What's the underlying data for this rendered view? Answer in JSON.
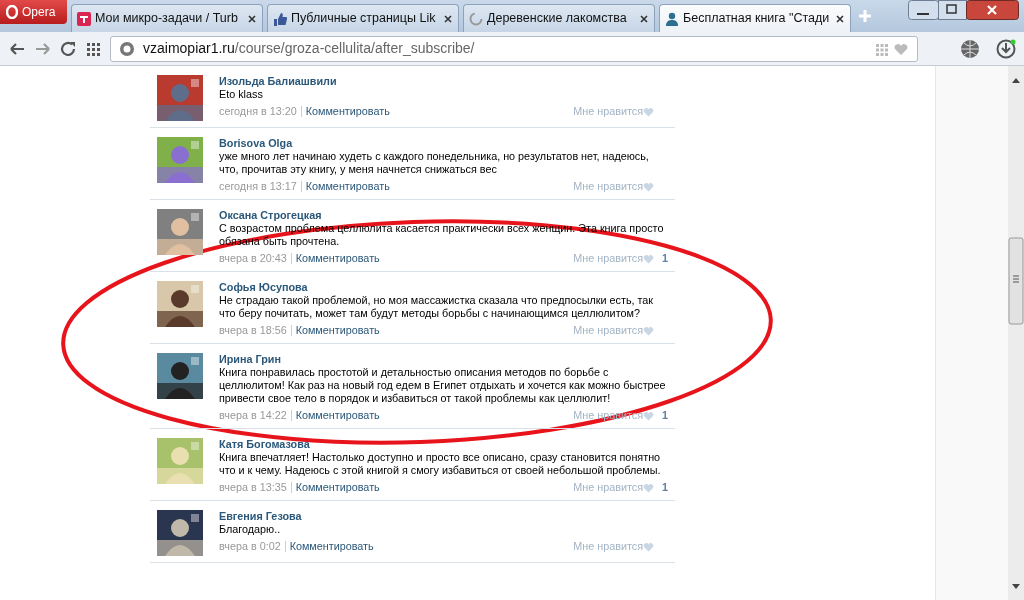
{
  "browser": {
    "menu_button": "Opera",
    "tabs": [
      {
        "title": "Мои микро-задачи / Turb",
        "selected": false
      },
      {
        "title": "Публичные страницы Lik",
        "selected": false
      },
      {
        "title": "Деревенские лакомства",
        "selected": false
      },
      {
        "title": "Бесплатная книга \"Стади",
        "selected": true
      }
    ],
    "address": {
      "host": "vzaimopiar1.ru",
      "path": "/course/groza-cellulita/after_subscribe/"
    }
  },
  "comments": [
    {
      "author": "Изольда Балиашвили",
      "text": "Eto klass",
      "time": "сегодня в 13:20",
      "reply": "Комментировать",
      "like": "Мне нравится"
    },
    {
      "author": "Borisova Olga",
      "text": "уже много лет начинаю худеть с каждого понедельника, но результатов нет, надеюсь, что, прочитав эту книгу, у меня начнется снижаться вес",
      "time": "сегодня в 13:17",
      "reply": "Комментировать",
      "like": "Мне нравится"
    },
    {
      "author": "Оксана Строгецкая",
      "text": "С возрастом проблема целлюлита касается практически всех женщин. Эта книга просто обязана быть прочтена.",
      "time": "вчера в 20:43",
      "reply": "Комментировать",
      "like": "Мне нравится",
      "likes": "1"
    },
    {
      "author": "Софья Юсупова",
      "text": "Не страдаю такой проблемой, но моя массажистка сказала что предпосылки есть, так что беру почитать, может там будут методы борьбы с начинающимся целлюлитом?",
      "time": "вчера в 18:56",
      "reply": "Комментировать",
      "like": "Мне нравится"
    },
    {
      "author": "Ирина Грин",
      "text": "Книга понравилась простотой и детальностью описания методов по борьбе с целлюлитом! Как раз на новый год едем в Египет отдыхать и хочется как можно быстрее привести свое тело в порядок и избавиться от такой проблемы как целлюлит!",
      "time": "вчера в 14:22",
      "reply": "Комментировать",
      "like": "Мне нравится",
      "likes": "1"
    },
    {
      "author": "Катя Богомазова",
      "text": "Книга впечатляет! Настолько доступно и просто все описано, сразу становится понятно что и к чему. Надеюсь с этой книгой я смогу избавиться от своей небольшой проблемы.",
      "time": "вчера в 13:35",
      "reply": "Комментировать",
      "like": "Мне нравится",
      "likes": "1"
    },
    {
      "author": "Евгения Гезова",
      "text": "Благодарю..",
      "time": "вчера в 0:02",
      "reply": "Комментировать",
      "like": "Мне нравится"
    }
  ]
}
